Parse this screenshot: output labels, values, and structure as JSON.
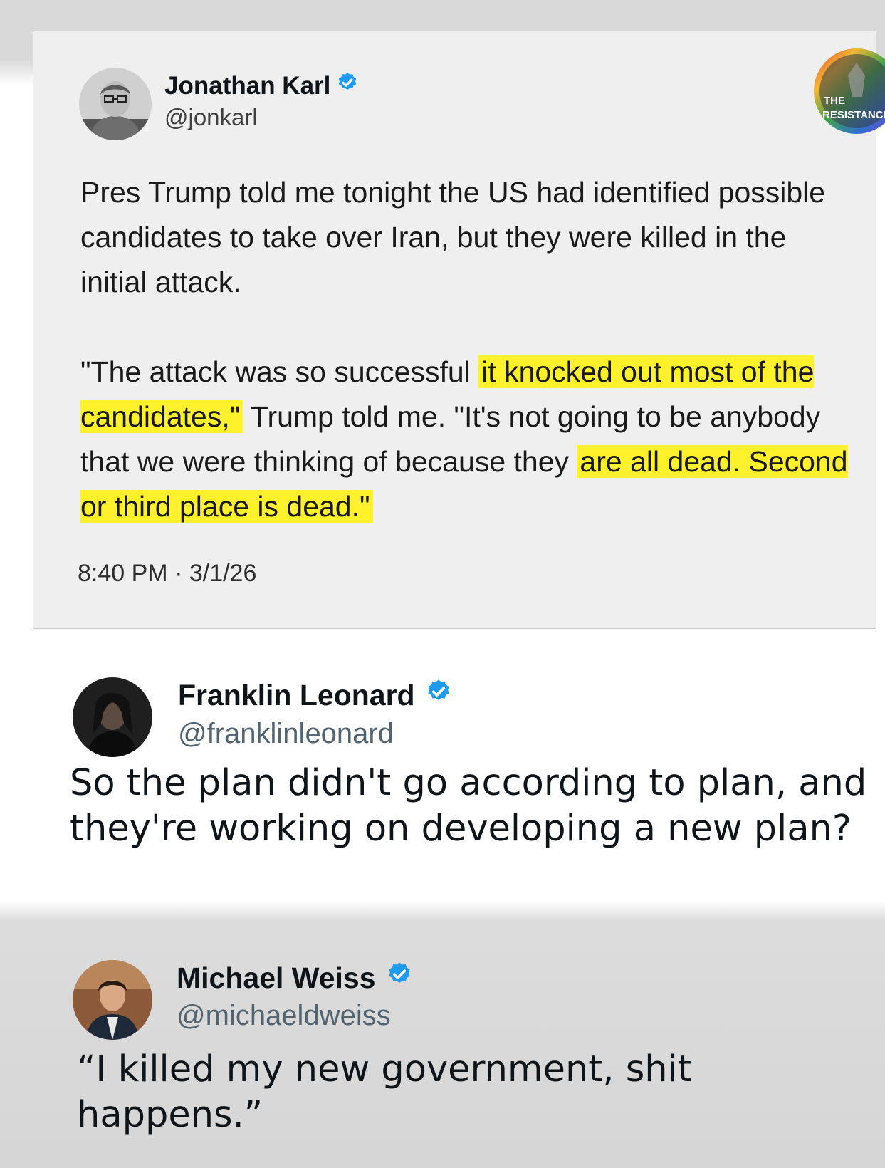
{
  "watermark": {
    "line1": "THE",
    "line2": "RESISTANCE"
  },
  "tweets": [
    {
      "name": "Jonathan Karl",
      "handle": "@jonkarl",
      "body_paragraph1": "Pres Trump told me tonight the US had identified possible candidates to take over Iran, but they were killed in the initial attack.",
      "body_p2_part1": "\"The attack was so successful ",
      "body_p2_highlight1": "it knocked out most of the candidates,\"",
      "body_p2_part2": " Trump told me. \"It's not going to be anybody that we were thinking of because they ",
      "body_p2_highlight2": "are all dead. Second or third place is dead.\"",
      "timestamp": "8:40 PM · 3/1/26"
    },
    {
      "name": "Franklin Leonard",
      "handle": "@franklinleonard",
      "body": "So the plan didn't go according to plan, and they're working on developing a new plan?"
    },
    {
      "name": "Michael Weiss",
      "handle": "@michaeldweiss",
      "body": "“I killed my new government, shit happens.”"
    }
  ],
  "colors": {
    "verified_blue": "#1d9bf0",
    "highlight_yellow": "#fff12b",
    "card_gray": "#efefef",
    "band_gray": "#d6d6d6"
  },
  "icons": [
    "verified-badge-icon",
    "avatar-photo"
  ]
}
